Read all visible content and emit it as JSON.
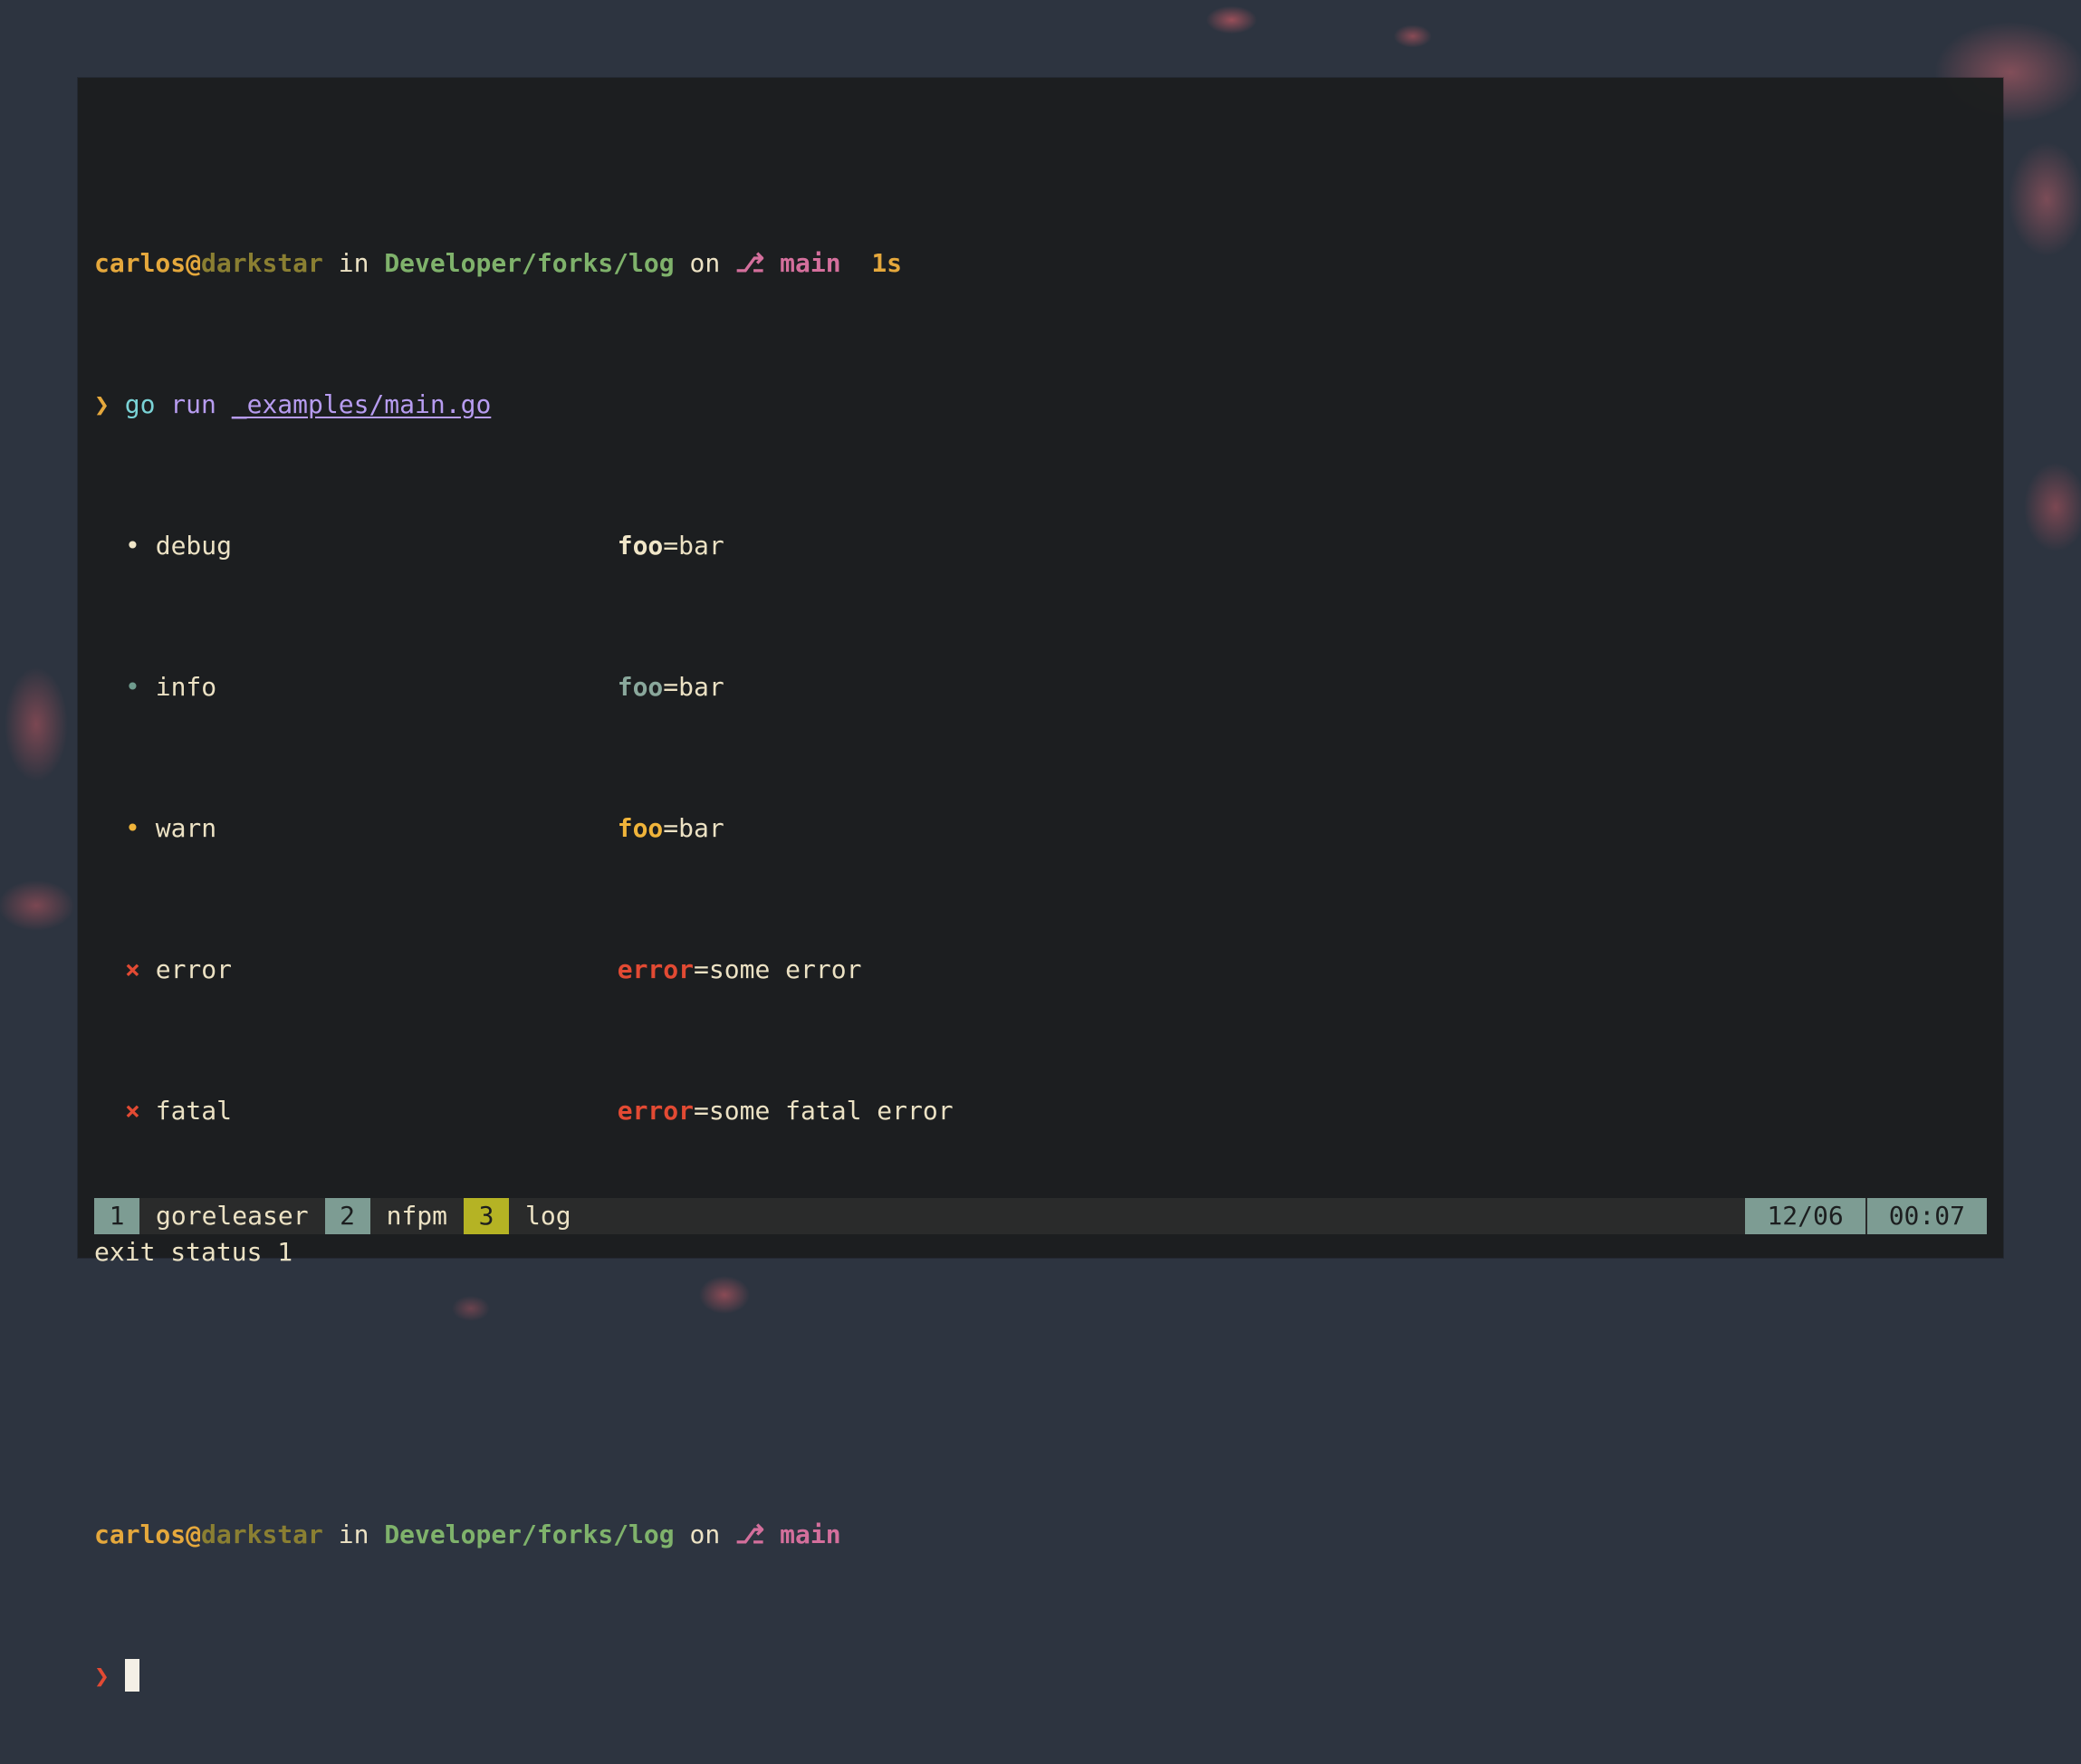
{
  "prompt1": {
    "user": "carlos",
    "at": "@",
    "host": "darkstar",
    "in_word": " in ",
    "path": "Developer/forks/log",
    "on_word": " on ",
    "branch_icon": "⎇",
    "branch": "main",
    "duration": "1s"
  },
  "command": {
    "prompt_symbol": "❯",
    "cmd": "go",
    "sub": "run",
    "file": "_examples/main.go"
  },
  "log_lines": [
    {
      "bullet": "•",
      "level": "debug",
      "key": "foo",
      "eq": "=",
      "value": "bar"
    },
    {
      "bullet": "•",
      "level": "info",
      "key": "foo",
      "eq": "=",
      "value": "bar"
    },
    {
      "bullet": "•",
      "level": "warn",
      "key": "foo",
      "eq": "=",
      "value": "bar"
    },
    {
      "bullet": "×",
      "level": "error",
      "key": "error",
      "eq": "=",
      "value": "some error"
    },
    {
      "bullet": "×",
      "level": "fatal",
      "key": "error",
      "eq": "=",
      "value": "some fatal error"
    }
  ],
  "exit_line": "exit status 1",
  "prompt2": {
    "user": "carlos",
    "at": "@",
    "host": "darkstar",
    "in_word": " in ",
    "path": "Developer/forks/log",
    "on_word": " on ",
    "branch_icon": "⎇",
    "branch": "main",
    "prompt_symbol": "❯"
  },
  "statusbar": {
    "windows": [
      {
        "index": "1",
        "name": "goreleaser"
      },
      {
        "index": "2",
        "name": "nfpm"
      },
      {
        "index": "3",
        "name": "log"
      }
    ],
    "date": "12/06",
    "time": "00:07"
  },
  "colors": {
    "accent_yellow": "#e5a83c",
    "path_green": "#7fb26b",
    "branch_pink": "#d46f9c",
    "error_red": "#e24a33",
    "status_teal": "#7d9c93",
    "active_window": "#b5b324"
  }
}
